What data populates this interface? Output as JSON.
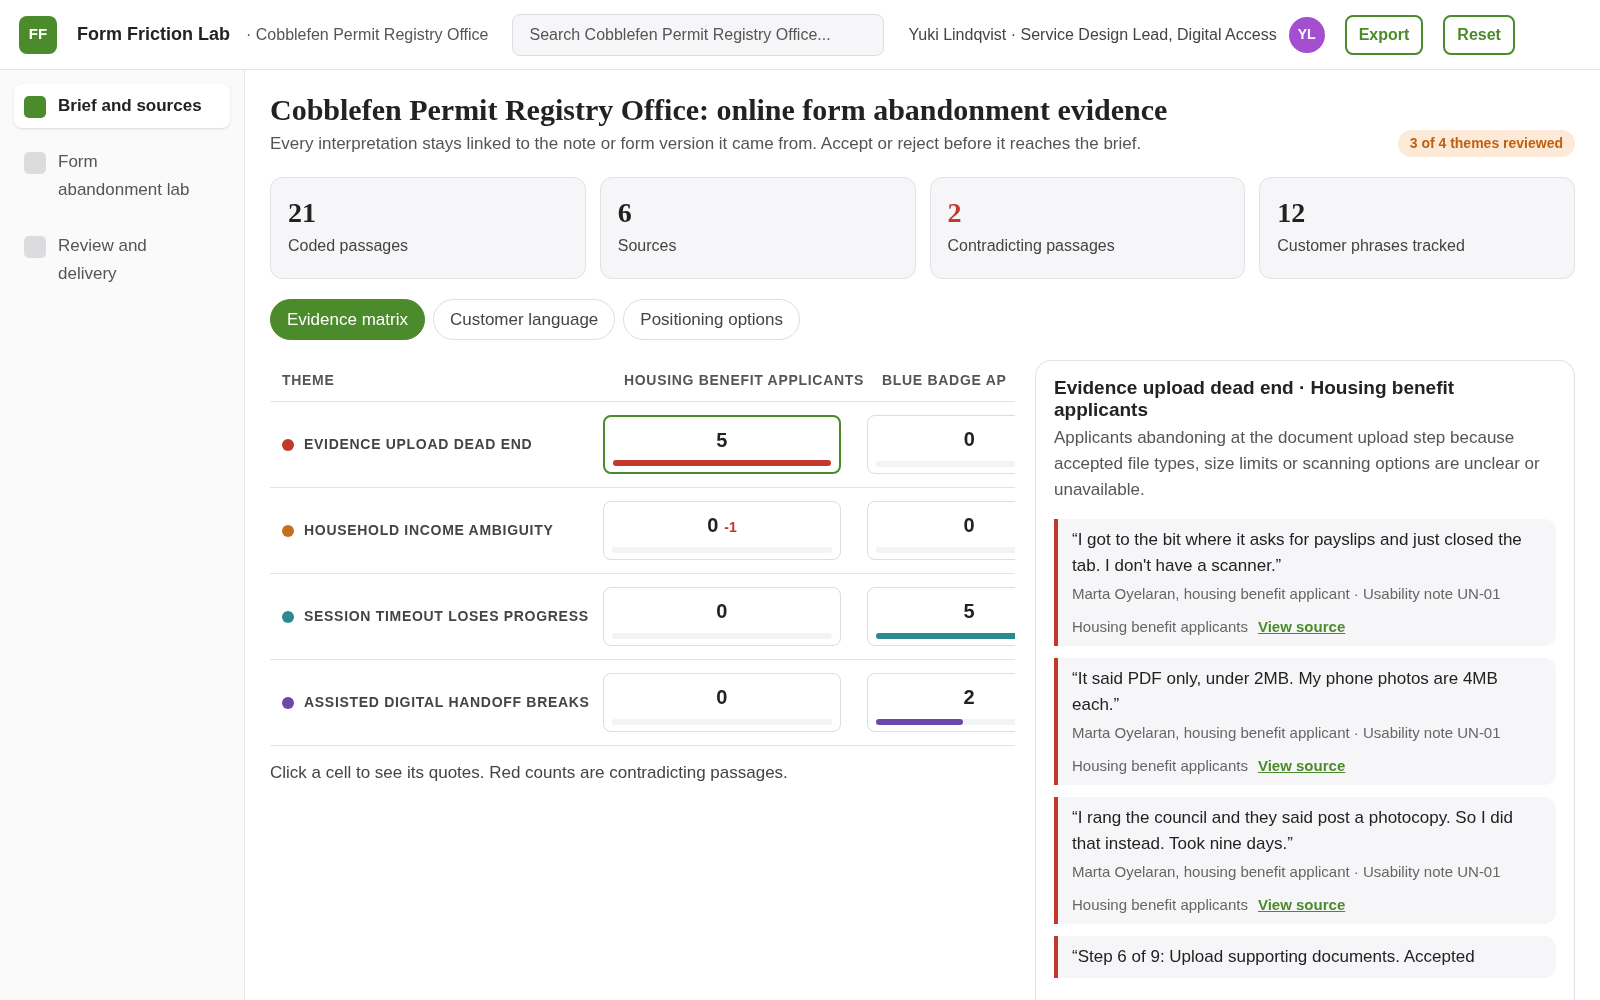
{
  "header": {
    "logo": "FF",
    "app_name": "Form Friction Lab",
    "org": "· Cobblefen Permit Registry Office",
    "search": {
      "placeholder": "Search Cobblefen Permit Registry Office..."
    },
    "user": "Yuki Lindqvist · Service Design Lead, Digital Access",
    "avatar": "YL",
    "buttons": [
      "Export",
      "Reset"
    ]
  },
  "sidebar": {
    "items": [
      {
        "label": "Brief and sources",
        "selected": true
      },
      {
        "label": "Form abandonment lab",
        "selected": false
      },
      {
        "label": "Review and delivery",
        "selected": false
      }
    ]
  },
  "page": {
    "title": "Cobblefen Permit Registry Office: online form abandonment evidence",
    "subtitle": "Every interpretation stays linked to the note or form version it came from. Accept or reject before it reaches the brief.",
    "badge": "3 of 4 themes reviewed"
  },
  "stats": [
    {
      "value": "21",
      "label": "Coded passages",
      "alert": false
    },
    {
      "value": "6",
      "label": "Sources",
      "alert": false
    },
    {
      "value": "2",
      "label": "Contradicting passages",
      "alert": true
    },
    {
      "value": "12",
      "label": "Customer phrases tracked",
      "alert": false
    }
  ],
  "tabs": [
    {
      "label": "Evidence matrix",
      "selected": true
    },
    {
      "label": "Customer language",
      "selected": false
    },
    {
      "label": "Positioning options",
      "selected": false
    }
  ],
  "matrix": {
    "columns": [
      "THEME",
      "HOUSING BENEFIT APPLICANTS",
      "BLUE BADGE AP"
    ],
    "rows": [
      {
        "cells": [
          {
            "kind": "theme",
            "text": "EVIDENCE UPLOAD DEAD END",
            "color": "#c0392b"
          },
          {
            "kind": "count",
            "count": "5",
            "level": 1,
            "selected": true
          },
          {
            "kind": "count",
            "count": "0",
            "selected": false
          }
        ]
      },
      {
        "cells": [
          {
            "kind": "theme",
            "text": "HOUSEHOLD INCOME AMBIGUITY",
            "color": "#c46f1c"
          },
          {
            "kind": "count",
            "count": "0",
            "contradicting": "-1",
            "selected": false
          },
          {
            "kind": "count",
            "count": "0",
            "selected": false
          }
        ]
      },
      {
        "cells": [
          {
            "kind": "theme",
            "text": "SESSION TIMEOUT LOSES PROGRESS",
            "color": "#2a8a8f"
          },
          {
            "kind": "count",
            "count": "0",
            "selected": false
          },
          {
            "kind": "count",
            "count": "5",
            "level": 1,
            "selected": false
          }
        ]
      },
      {
        "cells": [
          {
            "kind": "theme",
            "text": "ASSISTED DIGITAL HANDOFF BREAKS",
            "color": "#6b49a8"
          },
          {
            "kind": "count",
            "count": "0",
            "selected": false
          },
          {
            "kind": "count",
            "count": "2",
            "level": 0.4,
            "selected": false
          }
        ]
      }
    ],
    "footnote": "Click a cell to see its quotes. Red counts are contradicting passages."
  },
  "detail": {
    "title": "Evidence upload dead end · Housing benefit applicants",
    "description": "Applicants abandoning at the document upload step because accepted file types, size limits or scanning options are unclear or unavailable.",
    "quotes": [
      {
        "text": "“I got to the bit where it asks for payslips and just closed the tab. I don't have a scanner.”",
        "source": "Marta Oyelaran, housing benefit applicant · Usability note UN-01",
        "segment": "Housing benefit applicants",
        "link": "View source"
      },
      {
        "text": "“It said PDF only, under 2MB. My phone photos are 4MB each.”",
        "source": "Marta Oyelaran, housing benefit applicant · Usability note UN-01",
        "segment": "Housing benefit applicants",
        "link": "View source"
      },
      {
        "text": "“I rang the council and they said post a photocopy. So I did that instead. Took nine days.”",
        "source": "Marta Oyelaran, housing benefit applicant · Usability note UN-01",
        "segment": "Housing benefit applicants",
        "link": "View source"
      },
      {
        "text": "“Step 6 of 9: Upload supporting documents. Accepted"
      }
    ]
  }
}
